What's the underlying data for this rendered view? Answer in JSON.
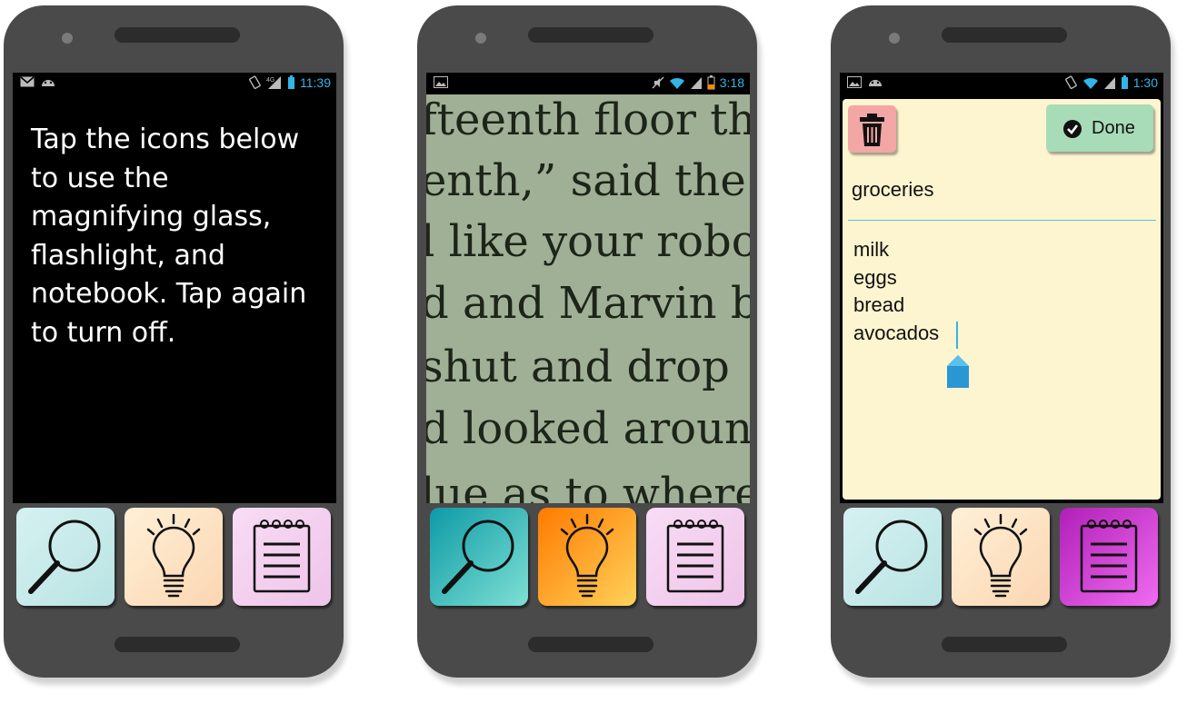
{
  "phones": [
    {
      "status": {
        "time": "11:39"
      },
      "intro_text": "Tap the icons below to use the magnifying glass, flashlight, and notebook. Tap again to turn off.",
      "dock": {
        "magnifier": {
          "icon": "magnifier-icon",
          "active": false,
          "color": "#c7eaea"
        },
        "flashlight": {
          "icon": "lightbulb-icon",
          "active": false,
          "color": "#fbe0c2"
        },
        "notebook": {
          "icon": "notepad-icon",
          "active": false,
          "color": "#f4cdef"
        }
      }
    },
    {
      "status": {
        "time": "3:18"
      },
      "magnified_text_lines": [
        "fteenth floor th",
        "enth,” said the",
        "l like your robo",
        "d and Marvin b",
        "shut and drop",
        "d looked aroun",
        "lue as to where"
      ],
      "dock": {
        "magnifier": {
          "icon": "magnifier-icon",
          "active": true,
          "color": "#1fb3b3"
        },
        "flashlight": {
          "icon": "lightbulb-icon",
          "active": true,
          "color": "#ff8a10"
        },
        "notebook": {
          "icon": "notepad-icon",
          "active": false,
          "color": "#f4cdef"
        }
      }
    },
    {
      "status": {
        "time": "1:30"
      },
      "notebook": {
        "delete_icon": "trash-icon",
        "done_label": "Done",
        "title": "groceries",
        "items": [
          "milk",
          "eggs",
          "bread",
          "avocados"
        ]
      },
      "dock": {
        "magnifier": {
          "icon": "magnifier-icon",
          "active": false,
          "color": "#c7eaea"
        },
        "flashlight": {
          "icon": "lightbulb-icon",
          "active": false,
          "color": "#fbe0c2"
        },
        "notebook": {
          "icon": "notepad-icon",
          "active": true,
          "color": "#c230c8"
        }
      }
    }
  ],
  "colors": {
    "phone_body": "#4a4a4a",
    "status_accent": "#33b5e5",
    "note_paper": "#fdf5cf"
  }
}
